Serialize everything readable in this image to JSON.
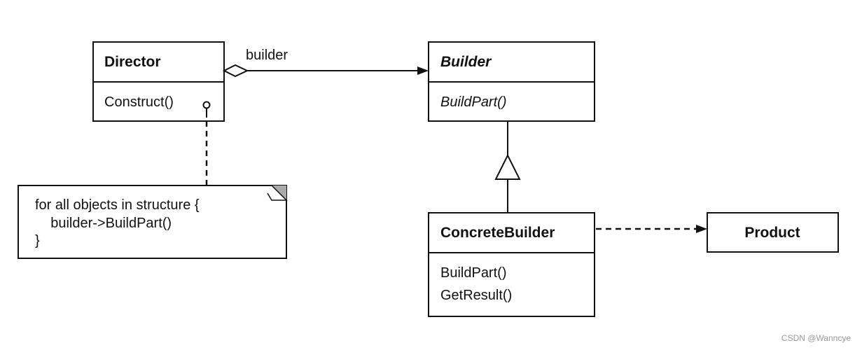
{
  "classes": {
    "director": {
      "name": "Director",
      "operations": [
        "Construct()"
      ]
    },
    "builder": {
      "name": "Builder",
      "operations": [
        "BuildPart()"
      ],
      "abstract": true
    },
    "concrete_builder": {
      "name": "ConcreteBuilder",
      "operations": [
        "BuildPart()",
        "GetResult()"
      ]
    },
    "product": {
      "name": "Product"
    }
  },
  "relations": {
    "aggregation_label": "builder"
  },
  "note": {
    "lines": [
      "for all objects in structure {",
      "    builder->BuildPart()",
      "}"
    ]
  },
  "watermark": "CSDN @Wanncye"
}
